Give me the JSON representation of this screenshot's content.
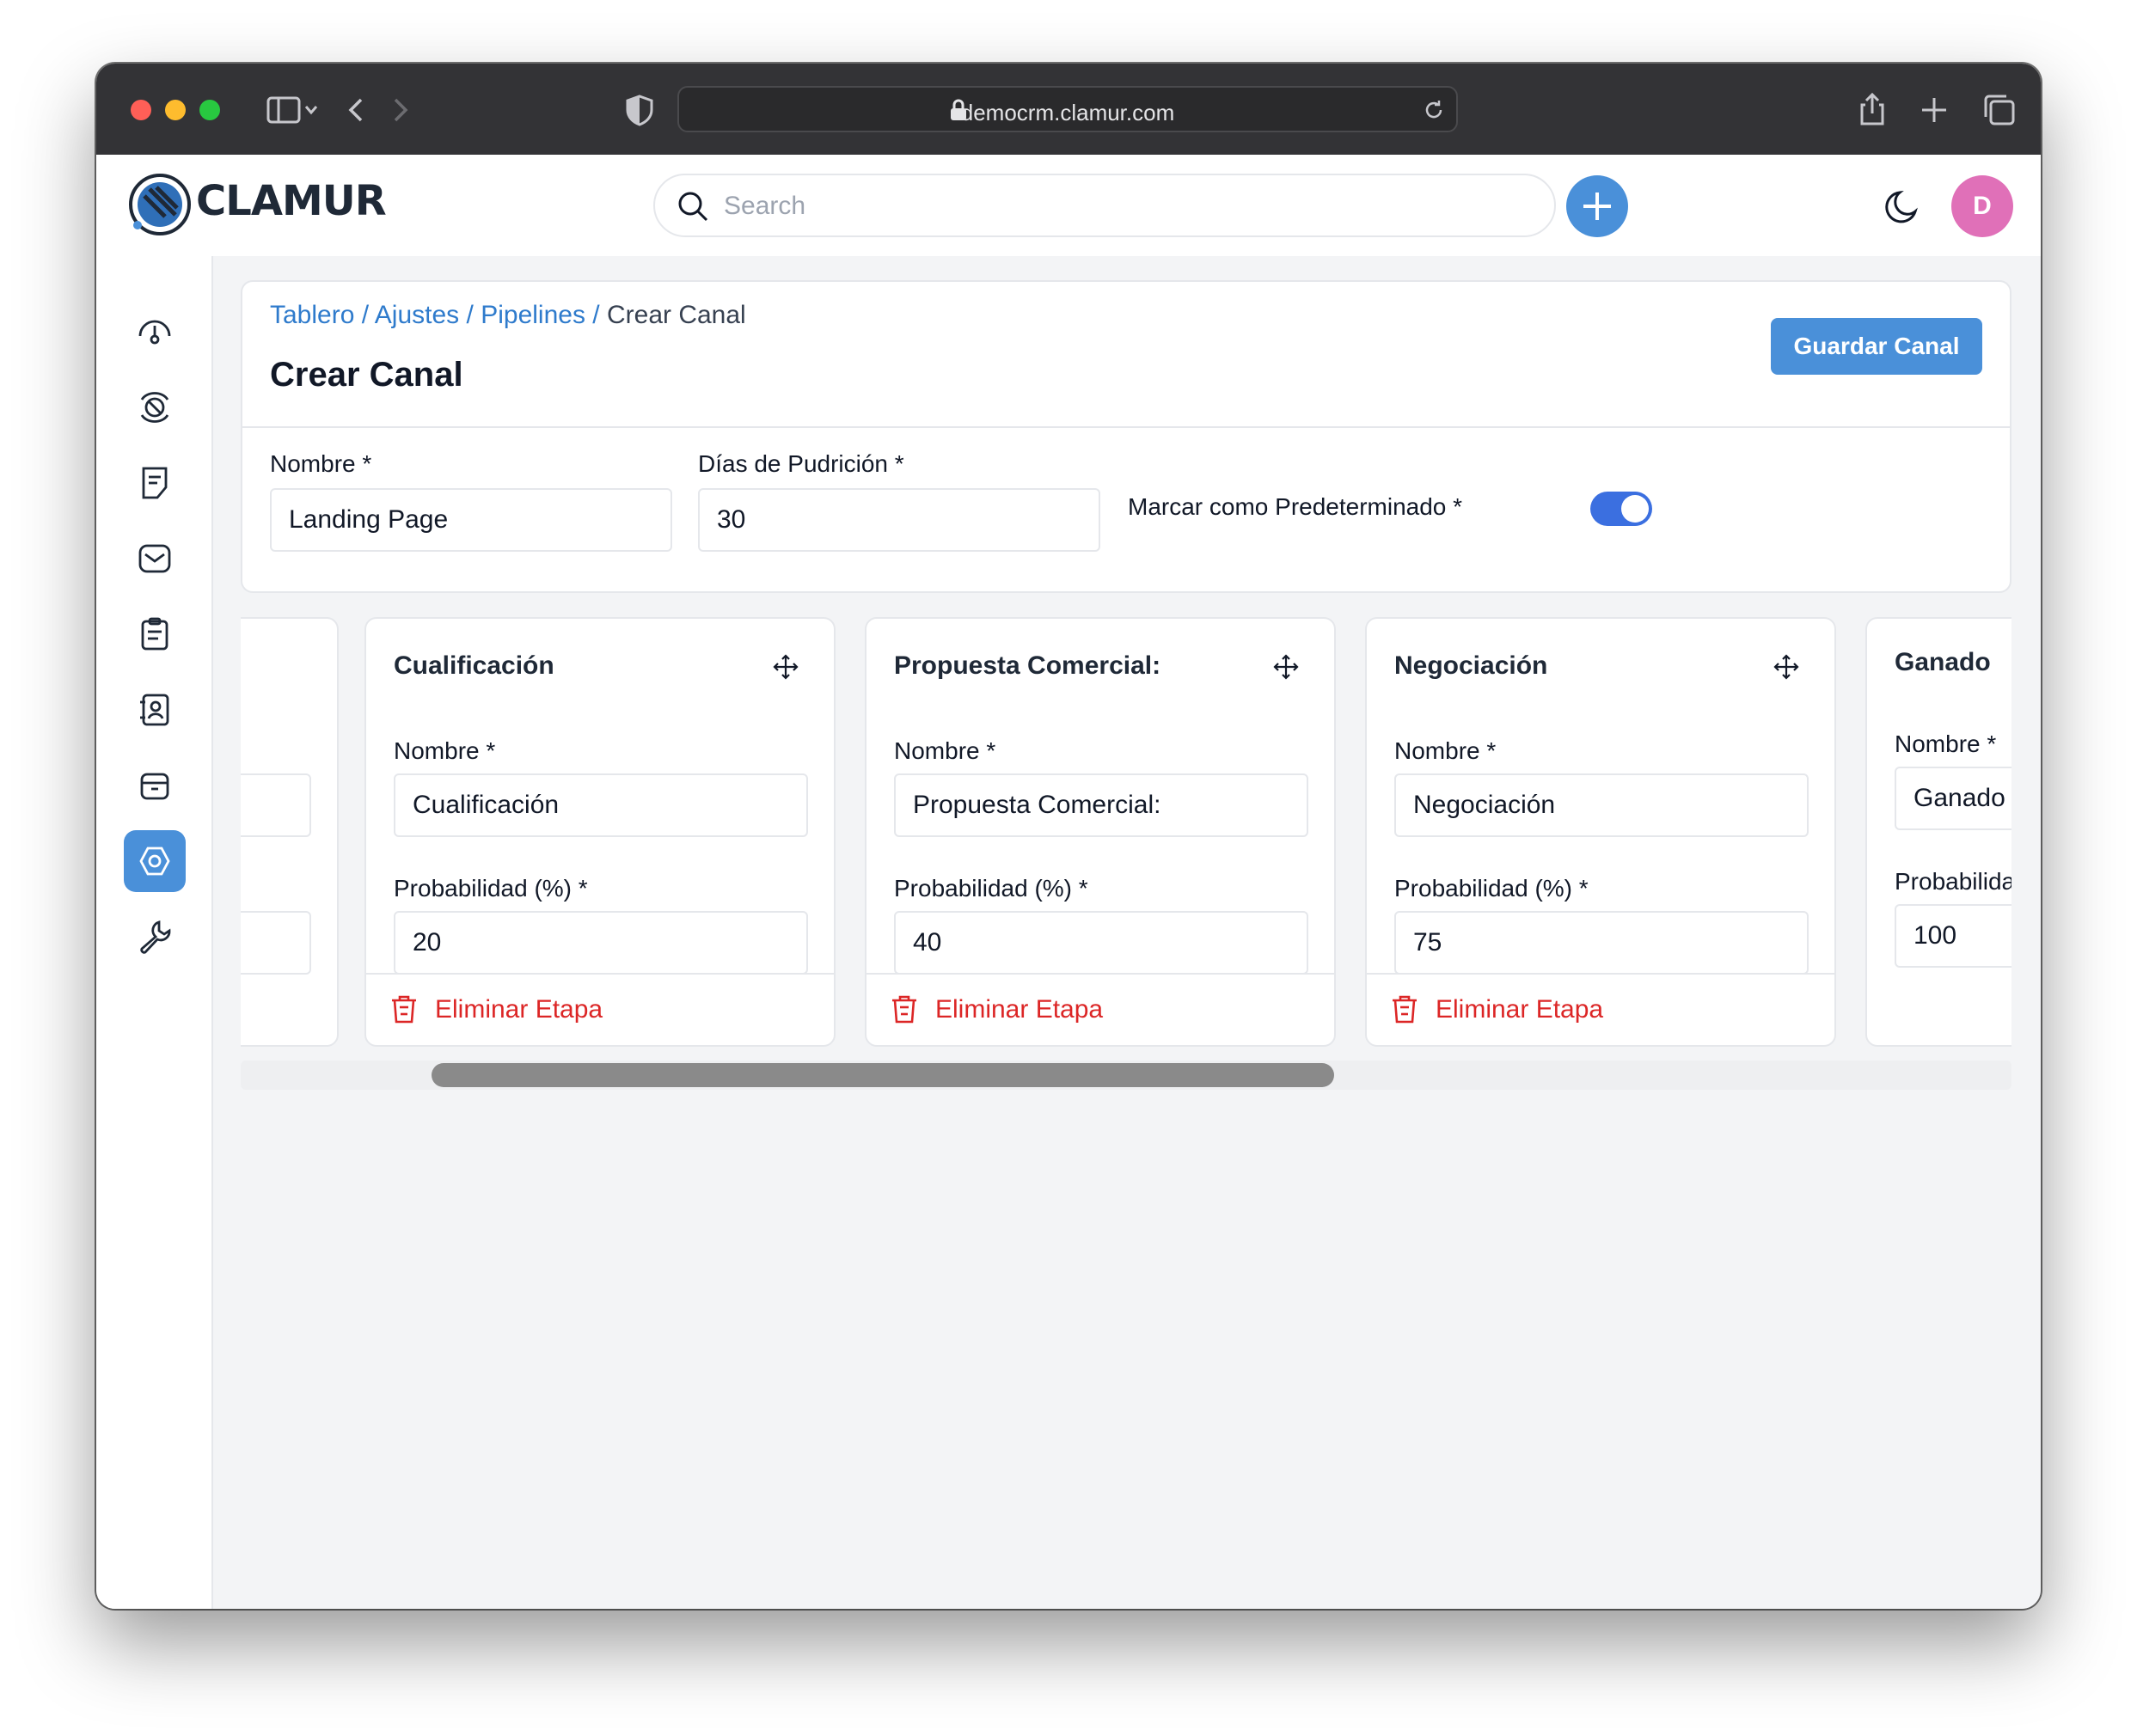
{
  "browser": {
    "url": "democrm.clamur.com"
  },
  "header": {
    "logo_text": "CLAMUR",
    "search_placeholder": "Search",
    "avatar_initial": "D"
  },
  "sidebar": {
    "items": [
      {
        "icon": "dashboard-gauge-icon",
        "active": false
      },
      {
        "icon": "leads-filter-icon",
        "active": false
      },
      {
        "icon": "quotes-note-icon",
        "active": false
      },
      {
        "icon": "mail-inbox-icon",
        "active": false
      },
      {
        "icon": "activities-clipboard-icon",
        "active": false
      },
      {
        "icon": "contacts-book-icon",
        "active": false
      },
      {
        "icon": "products-archive-icon",
        "active": false
      },
      {
        "icon": "settings-gear-icon",
        "active": true
      },
      {
        "icon": "configuration-wrench-icon",
        "active": false
      }
    ]
  },
  "breadcrumb": {
    "items": [
      "Tablero",
      "Ajustes",
      "Pipelines"
    ],
    "separator": "/",
    "current": "Crear Canal"
  },
  "page": {
    "title": "Crear Canal",
    "save_label": "Guardar Canal"
  },
  "form": {
    "name_label": "Nombre *",
    "name_value": "Landing Page",
    "rotten_label": "Días de Pudrición *",
    "rotten_value": "30",
    "default_label": "Marcar como Predeterminado *",
    "default_on": true
  },
  "stages": [
    {
      "title": "Cualificación",
      "name_label": "Nombre *",
      "name_value": "Cualificación",
      "prob_label": "Probabilidad (%) *",
      "prob_value": "20",
      "delete_label": "Eliminar Etapa"
    },
    {
      "title": "Propuesta Comercial:",
      "name_label": "Nombre *",
      "name_value": "Propuesta Comercial:",
      "prob_label": "Probabilidad (%) *",
      "prob_value": "40",
      "delete_label": "Eliminar Etapa"
    },
    {
      "title": "Negociación",
      "name_label": "Nombre *",
      "name_value": "Negociación",
      "prob_label": "Probabilidad (%) *",
      "prob_value": "75",
      "delete_label": "Eliminar Etapa"
    },
    {
      "title": "Ganado",
      "name_label": "Nombre *",
      "name_value": "Ganado",
      "prob_label": "Probabilidad (%) *",
      "prob_value": "100"
    }
  ],
  "colors": {
    "accent": "#4a90d9",
    "toggle": "#3b6fe0",
    "danger": "#dc2626",
    "avatar": "#e070b8"
  }
}
